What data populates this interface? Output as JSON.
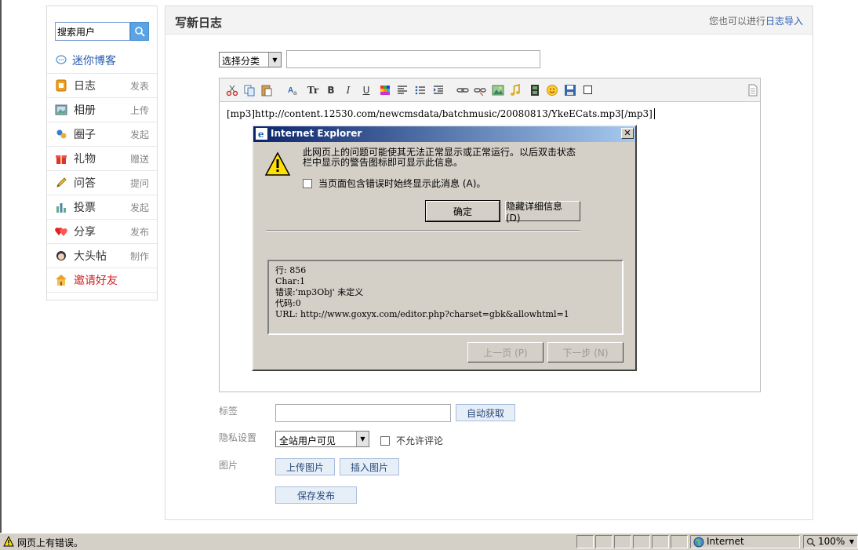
{
  "sidebar": {
    "search_placeholder": "搜索用户",
    "mini_blog": "迷你博客",
    "items": [
      {
        "label": "日志",
        "action": "发表"
      },
      {
        "label": "相册",
        "action": "上传"
      },
      {
        "label": "圈子",
        "action": "发起"
      },
      {
        "label": "礼物",
        "action": "赠送"
      },
      {
        "label": "问答",
        "action": "提问"
      },
      {
        "label": "投票",
        "action": "发起"
      },
      {
        "label": "分享",
        "action": "发布"
      },
      {
        "label": "大头帖",
        "action": "制作"
      },
      {
        "label": "邀请好友",
        "action": ""
      }
    ]
  },
  "main": {
    "title": "写新日志",
    "import_prefix": "您也可以进行",
    "import_link": "日志导入",
    "category_select": "选择分类",
    "editor_content": "[mp3]http://content.12530.com/newcmsdata/batchmusic/20080813/YkeECats.mp3[/mp3]"
  },
  "dialog": {
    "title": "Internet Explorer",
    "close": "✕",
    "message_line1": "此网页上的问题可能使其无法正常显示或正常运行。以后双击状态",
    "message_line2": "栏中显示的警告图标即可显示此信息。",
    "checkbox_label": "当页面包含错误时始终显示此消息 (A)。",
    "ok_button": "确定",
    "hide_details_button": "隐藏详细信息 (D)",
    "details": {
      "line": "行:  856",
      "char": "Char:1",
      "error": "错误:'mp3Obj' 未定义",
      "code": "代码:0",
      "url": "URL: http://www.goxyx.com/editor.php?charset=gbk&allowhtml=1"
    },
    "prev_button": "上一页 (P)",
    "next_button": "下一步 (N)"
  },
  "form": {
    "tags_label": "标签",
    "auto_fetch_button": "自动获取",
    "privacy_label": "隐私设置",
    "privacy_value": "全站用户可见",
    "no_comment_label": "不允许评论",
    "images_label": "图片",
    "upload_image_button": "上传图片",
    "insert_image_button": "插入图片",
    "save_publish_button": "保存发布"
  },
  "statusbar": {
    "text": "网页上有错误。",
    "zone": "Internet",
    "zoom": "100%"
  }
}
